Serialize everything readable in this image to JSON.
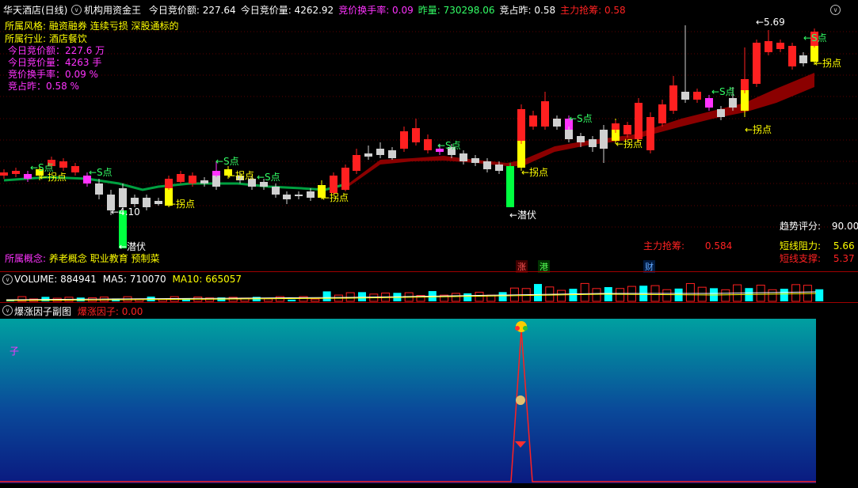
{
  "header": {
    "stock_name": "华天酒店(日线)",
    "indicator_name": "机构用资金王",
    "items": [
      {
        "label": "今日竞价额:",
        "value": "227.64",
        "color": "#ffffff"
      },
      {
        "label": "今日竞价量:",
        "value": "4262.92",
        "color": "#ffffff"
      },
      {
        "label": "竞价换手率:",
        "value": "0.09",
        "color": "#ff33ff"
      },
      {
        "label": "昨量:",
        "value": "730298.06",
        "color": "#33ff66"
      },
      {
        "label": "竞占昨:",
        "value": "0.58",
        "color": "#ffffff"
      },
      {
        "label": "主力抢筹:",
        "value": "0.58",
        "color": "#ff2222"
      }
    ]
  },
  "info": {
    "style_label": "所属风格:",
    "style_value": "融资融券 连续亏损 深股通标的",
    "industry_label": "所属行业:",
    "industry_value": "酒店餐饮",
    "auction_amount": "今日竞价额：227.6 万",
    "auction_volume": "今日竞价量：4263 手",
    "auction_turnover": "竞价换手率：0.09 %",
    "auction_ratio": "竞占昨：0.58 %",
    "concept_label": "所属概念:",
    "concept_value": "养老概念 职业教育 预制菜"
  },
  "right_panel": {
    "trend_label": "趋势评分:",
    "trend_value": "90.00",
    "short_resistance_label": "短线阻力:",
    "short_resistance_value": "5.66",
    "short_support_label": "短线支撑:",
    "short_support_value": "5.37",
    "main_grab_label": "主力抢筹:",
    "main_grab_value": "0.584"
  },
  "badges": {
    "zhang": "涨",
    "gang": "港",
    "cai": "财"
  },
  "price_marks": {
    "high": "5.69",
    "low": "4.10"
  },
  "signals": {
    "s_point": "S点",
    "guai_point": "←拐点",
    "qianfu": "←潜伏"
  },
  "volume": {
    "label": "VOLUME:",
    "value": "884941",
    "ma5_label": "MA5:",
    "ma5_value": "710070",
    "ma10_label": "MA10:",
    "ma10_value": "665057"
  },
  "sub_chart": {
    "title": "爆涨因子副图",
    "factor_label": "爆涨因子:",
    "factor_value": "0.00",
    "left_mark": "子"
  },
  "colors": {
    "up": "#ff2020",
    "down": "#d0d0d0",
    "yellow": "#ffff00",
    "green": "#00ff40",
    "magenta": "#ff33ff",
    "ribbon": "#8b0000",
    "cyan": "#00ffff"
  }
}
